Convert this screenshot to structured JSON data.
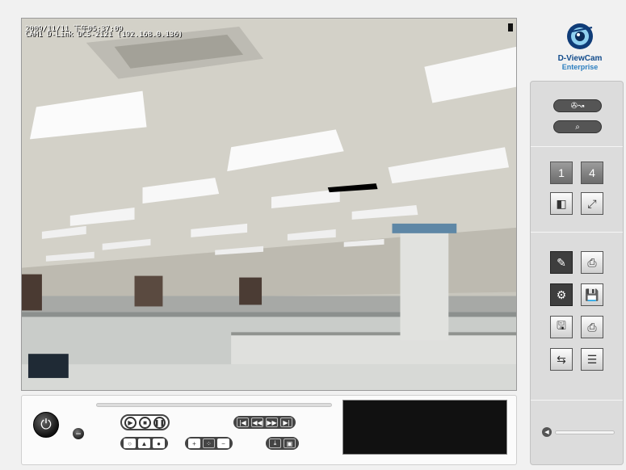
{
  "video": {
    "timestamp": "2009/11/11 下午05:37:09",
    "camera_label": "CAM1 D-Link DCS-2121 (192.168.0.136)"
  },
  "brand": {
    "name_line1": "D-ViewCam",
    "name_line2": "Enterprise",
    "colors": {
      "primary": "#124c8c",
      "secondary": "#2c7fc0"
    }
  },
  "panel": {
    "layout_tiles": [
      {
        "label": "1",
        "icon": "single-view-icon"
      },
      {
        "label": "4",
        "icon": "quad-view-icon"
      }
    ]
  },
  "controls": {
    "playback": [
      "play-icon",
      "stop-icon",
      "pause-icon"
    ],
    "navigation": [
      "first-frame-icon",
      "rewind-icon",
      "fast-forward-icon",
      "last-frame-icon"
    ],
    "modes": [
      "record-off-icon",
      "ptz-up-icon",
      "record-on-icon"
    ],
    "zoom": [
      "zoom-in-icon",
      "auto-focus-icon",
      "zoom-out-icon"
    ],
    "export": [
      "download-icon",
      "snapshot-save-icon"
    ]
  }
}
